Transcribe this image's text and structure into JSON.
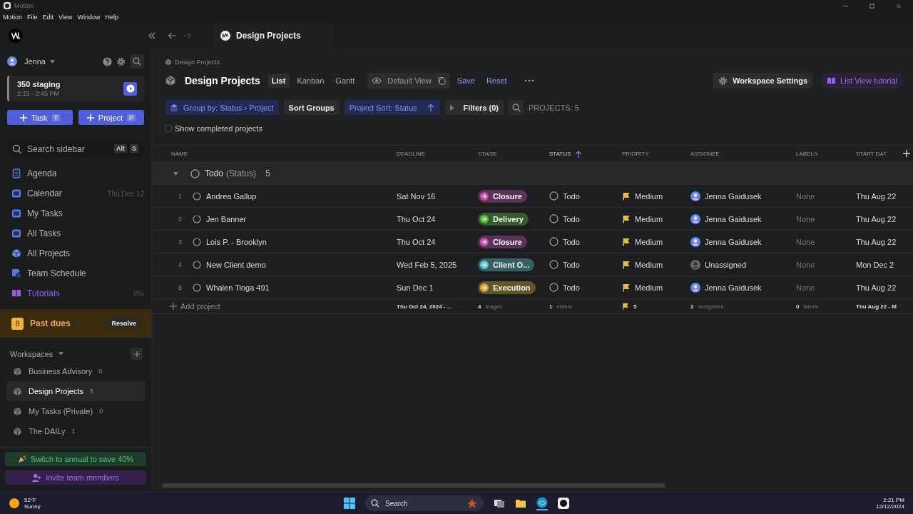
{
  "window": {
    "title": "Motion"
  },
  "menu": [
    "Motion",
    "File",
    "Edit",
    "View",
    "Window",
    "Help"
  ],
  "tab": {
    "label": "Design Projects"
  },
  "sidebar": {
    "user": "Jenna",
    "event": {
      "title": "350 staging",
      "time": "2:15 - 2:45 PM"
    },
    "create_buttons": [
      {
        "label": "Task",
        "shortcut": "T"
      },
      {
        "label": "Project",
        "shortcut": "P"
      }
    ],
    "search": {
      "placeholder": "Search sidebar",
      "keys": [
        "Alt",
        "S"
      ]
    },
    "nav": [
      {
        "kind": "agenda",
        "label": "Agenda"
      },
      {
        "kind": "calendar",
        "label": "Calendar",
        "meta": "Thu Dec 12"
      },
      {
        "kind": "mytasks",
        "label": "My Tasks"
      },
      {
        "kind": "alltasks",
        "label": "All Tasks"
      },
      {
        "kind": "projects",
        "label": "All Projects"
      },
      {
        "kind": "schedule",
        "label": "Team Schedule"
      },
      {
        "kind": "tutorials",
        "label": "Tutorials",
        "meta": "0%"
      }
    ],
    "past_dues": {
      "count": "8",
      "label": "Past dues",
      "action": "Resolve"
    },
    "workspaces": {
      "title": "Workspaces",
      "items": [
        {
          "name": "Business Advisory",
          "count": "0",
          "selected": false
        },
        {
          "name": "Design Projects",
          "count": "5",
          "selected": true
        },
        {
          "name": "My Tasks (Private)",
          "count": "0",
          "selected": false
        },
        {
          "name": "The DAILy",
          "count": "1",
          "selected": false
        }
      ]
    },
    "promo": "Switch to annual to save 40%",
    "invite": "Invite team members"
  },
  "main": {
    "breadcrumb": "Design Projects",
    "title": "Design Projects",
    "views": [
      {
        "label": "List",
        "selected": true
      },
      {
        "label": "Kanban",
        "selected": false
      },
      {
        "label": "Gantt",
        "selected": false
      }
    ],
    "view_name": "Default View",
    "save": "Save",
    "reset": "Reset",
    "workspace_settings": "Workspace Settings",
    "tutorial": "List View tutorial",
    "group_by": "Group by: Status › Project",
    "sort_groups": "Sort Groups",
    "project_sort": "Project Sort: Status",
    "filters": "Filters (0)",
    "count": "PROJECTS: 5",
    "show_completed": {
      "label": "Show completed projects",
      "checked": false
    }
  },
  "table": {
    "columns": [
      {
        "label": "NAME",
        "sorted": false
      },
      {
        "label": "DEADLINE",
        "sorted": false
      },
      {
        "label": "STAGE",
        "sorted": false
      },
      {
        "label": "STATUS",
        "sorted": true
      },
      {
        "label": "PRIORITY",
        "sorted": false
      },
      {
        "label": "ASSIGNEE",
        "sorted": false
      },
      {
        "label": "LABELS",
        "sorted": false
      },
      {
        "label": "START DAT",
        "sorted": false
      }
    ],
    "group": {
      "status": "Todo",
      "suffix": "(Status)",
      "count": "5",
      "expanded": true
    },
    "rows": [
      {
        "number": "1",
        "name": "Andrea Gallup",
        "deadline": "Sat Nov 16",
        "stage": {
          "label": "Closure",
          "color": "#c44fb0"
        },
        "status": "Todo",
        "priority": "Medium",
        "assignee": {
          "name": "Jenna Gaidusek",
          "assigned": true
        },
        "labels": "None",
        "start": "Thu Aug 22"
      },
      {
        "number": "2",
        "name": "Jen Banner",
        "deadline": "Thu Oct 24",
        "stage": {
          "label": "Delivery",
          "color": "#5cb83c"
        },
        "status": "Todo",
        "priority": "Medium",
        "assignee": {
          "name": "Jenna Gaidusek",
          "assigned": true
        },
        "labels": "None",
        "start": "Thu Aug 22"
      },
      {
        "number": "3",
        "name": "Lois P. - Brooklyn",
        "deadline": "Thu Oct 24",
        "stage": {
          "label": "Closure",
          "color": "#c44fb0"
        },
        "status": "Todo",
        "priority": "Medium",
        "assignee": {
          "name": "Jenna Gaidusek",
          "assigned": true
        },
        "labels": "None",
        "start": "Thu Aug 22"
      },
      {
        "number": "4",
        "name": "New Client demo",
        "deadline": "Wed Feb 5, 2025",
        "stage": {
          "label": "Client O...",
          "color": "#5cc6d0"
        },
        "status": "Todo",
        "priority": "Medium",
        "assignee": {
          "name": "Unassigned",
          "assigned": false
        },
        "labels": "None",
        "start": "Mon Dec 2"
      },
      {
        "number": "5",
        "name": "Whalen Tioga 491",
        "deadline": "Sun Dec 1",
        "stage": {
          "label": "Execution",
          "color": "#d4a93c"
        },
        "status": "Todo",
        "priority": "Medium",
        "assignee": {
          "name": "Jenna Gaidusek",
          "assigned": true
        },
        "labels": "None",
        "start": "Thu Aug 22"
      }
    ],
    "summary": {
      "add": "Add project",
      "deadline": "Thu Oct 24, 2024 - ...",
      "stages": [
        "4",
        "stages"
      ],
      "status": [
        "1",
        "status"
      ],
      "priority": "5",
      "assignees": [
        "2",
        "assignees"
      ],
      "labels": [
        "0",
        "labels"
      ],
      "start": "Thu Aug 22 - M"
    }
  },
  "taskbar": {
    "temperature": "52°F",
    "weather": "Sunny",
    "search": "Search",
    "time": "2:21 PM",
    "date": "12/12/2024"
  }
}
